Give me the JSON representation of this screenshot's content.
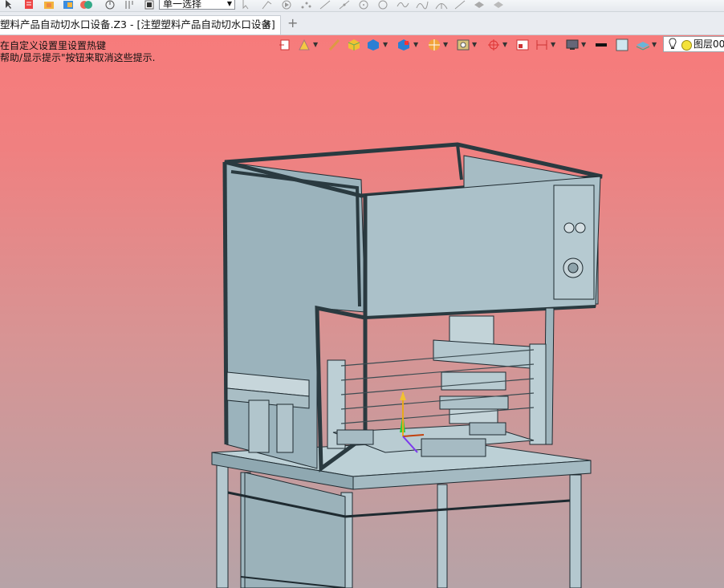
{
  "toolbar": {
    "selection_mode": "单一选择",
    "icons": [
      "pointer-icon",
      "list-icon",
      "folder-icon",
      "table-icon",
      "color-icon",
      "history-icon",
      "filter-icon",
      "stop-icon",
      "cursor-icon",
      "sketch-icon",
      "play-icon",
      "point-icon",
      "line-icon",
      "circle-icon",
      "arc-icon",
      "curve-icon",
      "spline-icon",
      "arrow-icon",
      "surface-icon",
      "layer-icon"
    ]
  },
  "tabs": {
    "active_label": "塑料产品自动切水口设备.Z3 - [注塑塑料产品自动切水口设备]",
    "close_symbol": "✕",
    "add_symbol": "+"
  },
  "viewport": {
    "hint_line1": "在自定义设置里设置热键",
    "hint_line2": "帮助/显示提示\"按钮来取消这些提示.",
    "layer_label": "图层00",
    "background_top": "#f77b7b",
    "background_bottom": "#b6a3a7",
    "model_color": "#aec6cf",
    "model_edge": "#1e2a30"
  }
}
